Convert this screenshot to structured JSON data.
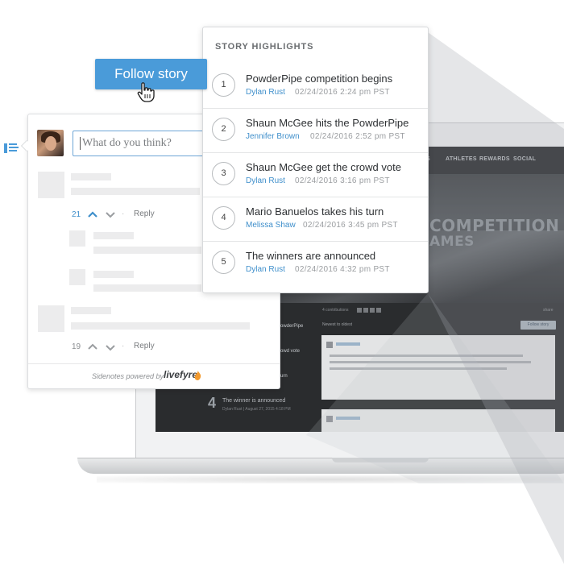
{
  "follow_button": {
    "label": "Follow story"
  },
  "highlights": {
    "heading": "STORY HIGHLIGHTS",
    "items": [
      {
        "number": "1",
        "title": "PowderPipe competition begins",
        "author": "Dylan Rust",
        "time": "02/24/2016  2:24 pm  PST"
      },
      {
        "number": "2",
        "title": "Shaun McGee hits the PowderPipe",
        "author": "Jennifer Brown",
        "time": "02/24/2016  2:52 pm  PST"
      },
      {
        "number": "3",
        "title": "Shaun McGee get the crowd vote",
        "author": "Dylan Rust",
        "time": "02/24/2016  3:16 pm  PST"
      },
      {
        "number": "4",
        "title": "Mario Banuelos takes his turn",
        "author": "Melissa Shaw",
        "time": "02/24/2016  3:45 pm  PST"
      },
      {
        "number": "5",
        "title": "The winners are announced",
        "author": "Dylan Rust",
        "time": "02/24/2016  4:32 pm  PST"
      }
    ]
  },
  "comment_box": {
    "placeholder": "What do you think?",
    "threads": [
      {
        "votes": "21",
        "reply_label": "Reply",
        "accent": "#3f8fcb"
      },
      {
        "votes": "19",
        "reply_label": "Reply",
        "accent": "#8a8d90"
      }
    ],
    "powered_by": "Sidenotes powered by",
    "brand": "livefyre"
  },
  "laptop_site": {
    "nav": [
      "S",
      "ATHLETES",
      "REWARDS",
      "SOCIAL"
    ],
    "hero_title_line1": "COMPETITION",
    "hero_title_line2": "AMES",
    "contributions": "4 contributions",
    "sort": "Newest to oldest",
    "follow": "Follow story",
    "share": "share",
    "left_list": [
      {
        "title": "owderPipe",
        "meta": ""
      },
      {
        "title": "owd vote",
        "meta": ""
      },
      {
        "title": "urn",
        "meta": ""
      }
    ],
    "last_item": {
      "number": "4",
      "title": "The winner is announced",
      "meta": "Dylan Rust  |  August 27, 2015 4:18 PM"
    }
  },
  "colors": {
    "accent": "#4a9bd9",
    "link": "#3f8fcb",
    "screen_bg": "#1d1f21"
  }
}
